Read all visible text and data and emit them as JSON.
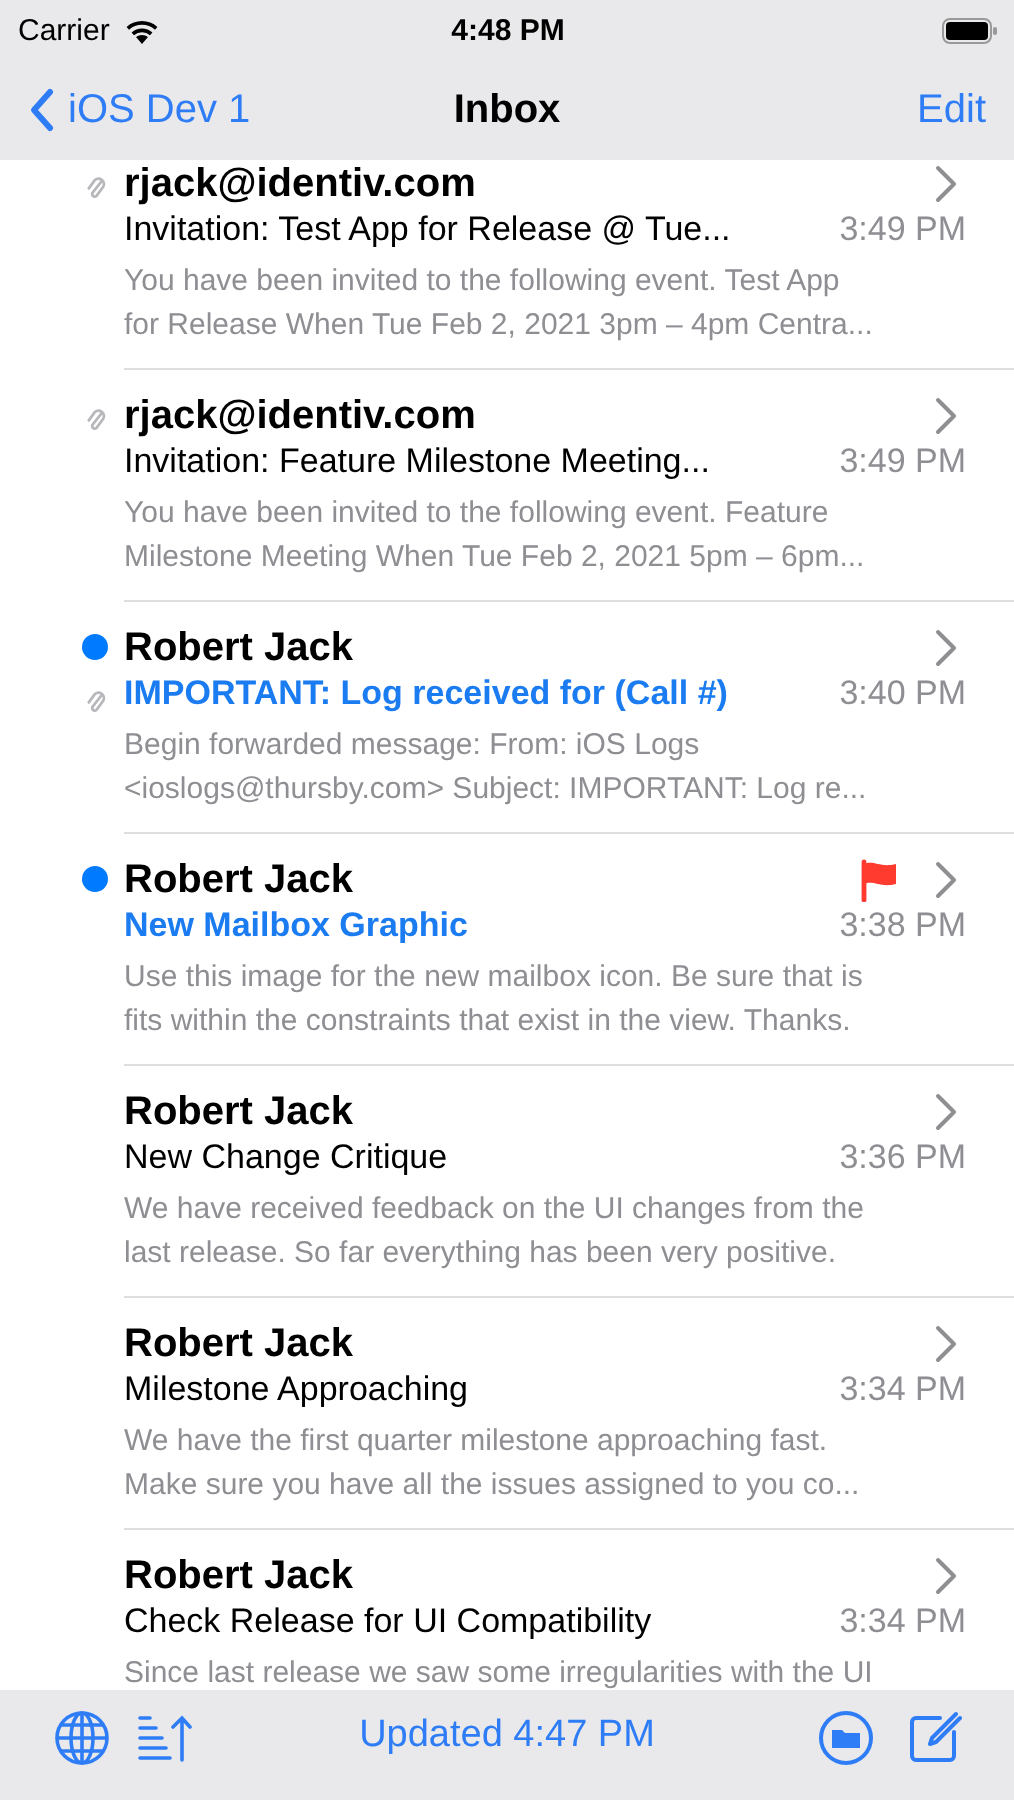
{
  "status_bar": {
    "carrier": "Carrier",
    "time": "4:48 PM"
  },
  "nav": {
    "back": "iOS Dev 1",
    "title": "Inbox",
    "action": "Edit"
  },
  "messages": [
    {
      "sender": "rjack@identiv.com",
      "subject": "Invitation: Test App for Release @ Tue...",
      "time": "3:49 PM",
      "preview": [
        "You have been invited to the following event. Test App",
        "for Release When  Tue Feb 2, 2021 3pm – 4pm Centra..."
      ],
      "unread": false,
      "attachment": true,
      "flagged": false
    },
    {
      "sender": "rjack@identiv.com",
      "subject": "Invitation: Feature Milestone Meeting...",
      "time": "3:49 PM",
      "preview": [
        "You have been invited to the following event. Feature",
        "Milestone Meeting When  Tue Feb 2, 2021 5pm – 6pm..."
      ],
      "unread": false,
      "attachment": true,
      "flagged": false
    },
    {
      "sender": "Robert Jack",
      "subject": "IMPORTANT: Log received for (Call #)",
      "time": "3:40 PM",
      "preview": [
        "Begin forwarded message: From: iOS Logs",
        "<ioslogs@thursby.com> Subject: IMPORTANT: Log re..."
      ],
      "unread": true,
      "attachment": true,
      "flagged": false
    },
    {
      "sender": "Robert Jack",
      "subject": "New Mailbox Graphic",
      "time": "3:38 PM",
      "preview": [
        "Use this image for the new mailbox icon. Be sure that is",
        "fits within the constraints that exist in the view. Thanks."
      ],
      "unread": true,
      "attachment": false,
      "flagged": true
    },
    {
      "sender": "Robert Jack",
      "subject": "New Change Critique",
      "time": "3:36 PM",
      "preview": [
        "We have received feedback on the UI changes from the",
        "last release. So far everything has been very positive."
      ],
      "unread": false,
      "attachment": false,
      "flagged": false
    },
    {
      "sender": "Robert Jack",
      "subject": "Milestone Approaching",
      "time": "3:34 PM",
      "preview": [
        "We have the first quarter milestone approaching fast.",
        "Make sure you have all the issues assigned to you co..."
      ],
      "unread": false,
      "attachment": false,
      "flagged": false
    },
    {
      "sender": "Robert Jack",
      "subject": "Check Release for UI Compatibility",
      "time": "3:34 PM",
      "preview": [
        "Since last release we saw some irregularities with the UI"
      ],
      "unread": false,
      "attachment": false,
      "flagged": false
    }
  ],
  "toolbar": {
    "status": "Updated 4:47 PM"
  }
}
